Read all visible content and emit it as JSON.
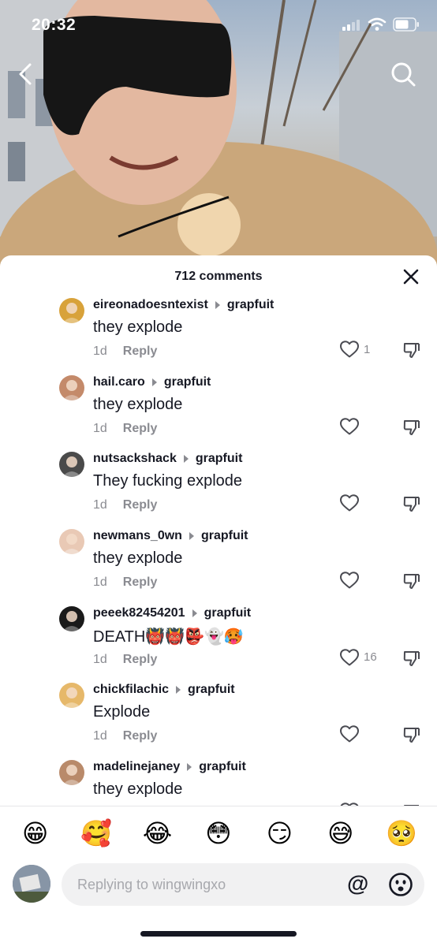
{
  "status_bar": {
    "time": "20:32"
  },
  "sheet": {
    "title": "712 comments"
  },
  "comments": [
    {
      "username": "eireonadoesntexist",
      "reply_to": "grapfuit",
      "text": "they explode",
      "age": "1d",
      "reply_label": "Reply",
      "likes": "1",
      "avatar_color": "#d8a23a"
    },
    {
      "username": "hail.caro",
      "reply_to": "grapfuit",
      "text": "they explode",
      "age": "1d",
      "reply_label": "Reply",
      "likes": "",
      "avatar_color": "#c48a6a"
    },
    {
      "username": "nutsackshack",
      "reply_to": "grapfuit",
      "text": "They fucking explode",
      "age": "1d",
      "reply_label": "Reply",
      "likes": "",
      "avatar_color": "#4a4a4a"
    },
    {
      "username": "newmans_0wn",
      "reply_to": "grapfuit",
      "text": "they explode",
      "age": "1d",
      "reply_label": "Reply",
      "likes": "",
      "avatar_color": "#e9c9b5"
    },
    {
      "username": "peeek82454201",
      "reply_to": "grapfuit",
      "text": "DEATH👹👹👺👻🥵",
      "age": "1d",
      "reply_label": "Reply",
      "likes": "16",
      "avatar_color": "#1a1a1a"
    },
    {
      "username": "chickfilachic",
      "reply_to": "grapfuit",
      "text": "Explode",
      "age": "1d",
      "reply_label": "Reply",
      "likes": "",
      "avatar_color": "#e6b86a"
    },
    {
      "username": "madelinejaney",
      "reply_to": "grapfuit",
      "text": "they explode",
      "age": "",
      "reply_label": "",
      "likes": "",
      "avatar_color": "#b98a6a"
    }
  ],
  "emoji_bar": [
    "😁",
    "🥰",
    "😂",
    "😳",
    "😏",
    "😅",
    "🥺"
  ],
  "input": {
    "placeholder": "Replying to wingwingxo",
    "at_label": "@"
  },
  "colors": {
    "text": "#161823",
    "muted": "#8a8b91",
    "input_bg": "#f1f1f2"
  }
}
